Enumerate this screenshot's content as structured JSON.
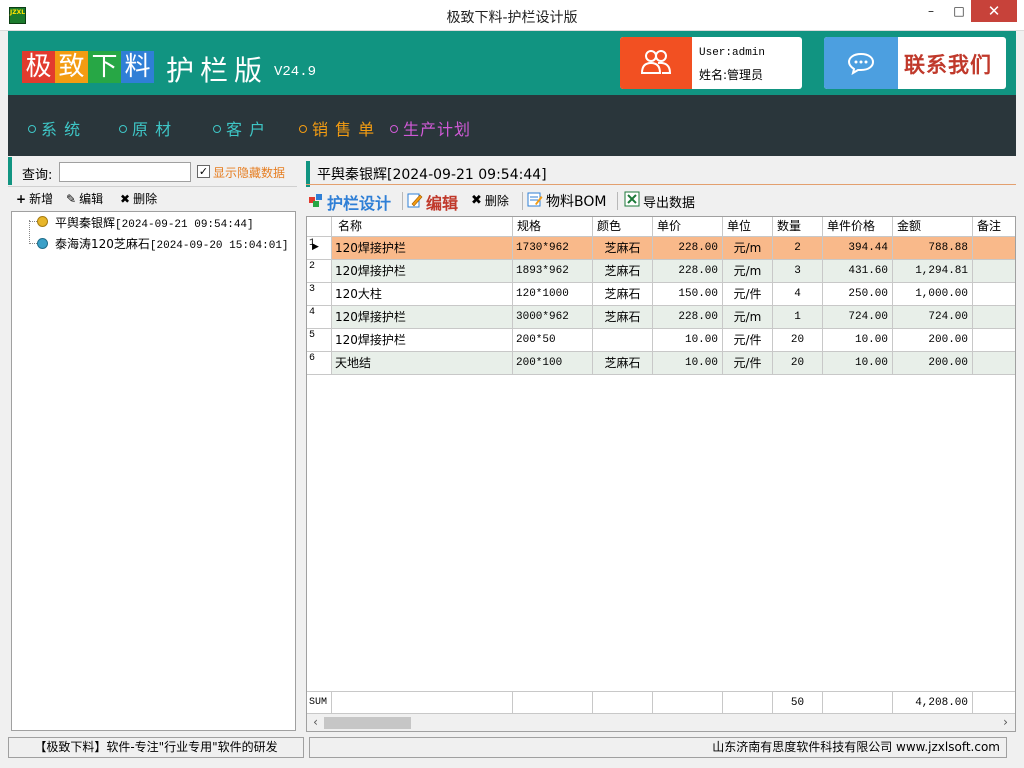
{
  "window": {
    "title": "极致下料-护栏设计版",
    "logo_text": "JZXL",
    "minimize": "–",
    "maximize": "□",
    "close": "✕"
  },
  "banner": {
    "logo_chars": [
      {
        "char": "极",
        "color": "#e23b2e"
      },
      {
        "char": "致",
        "color": "#f39c12"
      },
      {
        "char": "下",
        "color": "#27a745"
      },
      {
        "char": "料",
        "color": "#2f7fd6"
      }
    ],
    "logo_suffix": "护栏版",
    "version": "V24.9",
    "user_label": "User:admin",
    "name_label": "姓名:管理员",
    "contact": "联系我们"
  },
  "nav": [
    {
      "label": "系 统",
      "color": "#3ec6c6"
    },
    {
      "label": "原 材",
      "color": "#3ec6c6"
    },
    {
      "label": "客 户",
      "color": "#3ec6c6"
    },
    {
      "label": "销 售 单",
      "color": "#f39c12"
    },
    {
      "label": "生产计划",
      "color": "#d05ad6"
    }
  ],
  "left": {
    "search_label": "查询:",
    "search_value": "",
    "show_hidden_checked": true,
    "show_hidden_label": "显示隐藏数据",
    "toolbar": {
      "add": "新增",
      "edit": "编辑",
      "delete": "删除"
    },
    "tree": [
      {
        "name": "平舆秦银辉",
        "time": "[2024-09-21 09:54:44]",
        "dot": "#e8b62a"
      },
      {
        "name": "泰海涛120芝麻石",
        "time": "[2024-09-20 15:04:01]",
        "dot": "#3aa0c8"
      }
    ]
  },
  "right": {
    "doc_title": "平舆秦银辉[2024-09-21 09:54:44]",
    "toolbar": {
      "design": "护栏设计",
      "edit": "编辑",
      "delete": "删除",
      "bom": "物料BOM",
      "export": "导出数据"
    },
    "columns": [
      "名称",
      "规格",
      "颜色",
      "单价",
      "单位",
      "数量",
      "单件价格",
      "金额",
      "备注"
    ],
    "rows": [
      {
        "idx": "1",
        "name": "120焊接护栏",
        "spec": "1730*962",
        "color": "芝麻石",
        "price": "228.00",
        "unit": "元/m",
        "qty": "2",
        "unit_price": "394.44",
        "amount": "788.88",
        "note": ""
      },
      {
        "idx": "2",
        "name": "120焊接护栏",
        "spec": "1893*962",
        "color": "芝麻石",
        "price": "228.00",
        "unit": "元/m",
        "qty": "3",
        "unit_price": "431.60",
        "amount": "1,294.81",
        "note": ""
      },
      {
        "idx": "3",
        "name": "120大柱",
        "spec": "120*1000",
        "color": "芝麻石",
        "price": "150.00",
        "unit": "元/件",
        "qty": "4",
        "unit_price": "250.00",
        "amount": "1,000.00",
        "note": ""
      },
      {
        "idx": "4",
        "name": "120焊接护栏",
        "spec": "3000*962",
        "color": "芝麻石",
        "price": "228.00",
        "unit": "元/m",
        "qty": "1",
        "unit_price": "724.00",
        "amount": "724.00",
        "note": ""
      },
      {
        "idx": "5",
        "name": "120焊接护栏",
        "spec": "200*50",
        "color": "",
        "price": "10.00",
        "unit": "元/件",
        "qty": "20",
        "unit_price": "10.00",
        "amount": "200.00",
        "note": ""
      },
      {
        "idx": "6",
        "name": "天地结",
        "spec": "200*100",
        "color": "芝麻石",
        "price": "10.00",
        "unit": "元/件",
        "qty": "20",
        "unit_price": "10.00",
        "amount": "200.00",
        "note": ""
      }
    ],
    "selected_row_color": "#f9b98a",
    "alt_row_color": "#e8efe9",
    "sum": {
      "label": "SUM",
      "qty": "50",
      "amount": "4,208.00"
    }
  },
  "status": {
    "left": "【极致下料】软件-专注\"行业专用\"软件的研发",
    "right": "山东济南有思度软件科技有限公司   www.jzxlsoft.com"
  }
}
